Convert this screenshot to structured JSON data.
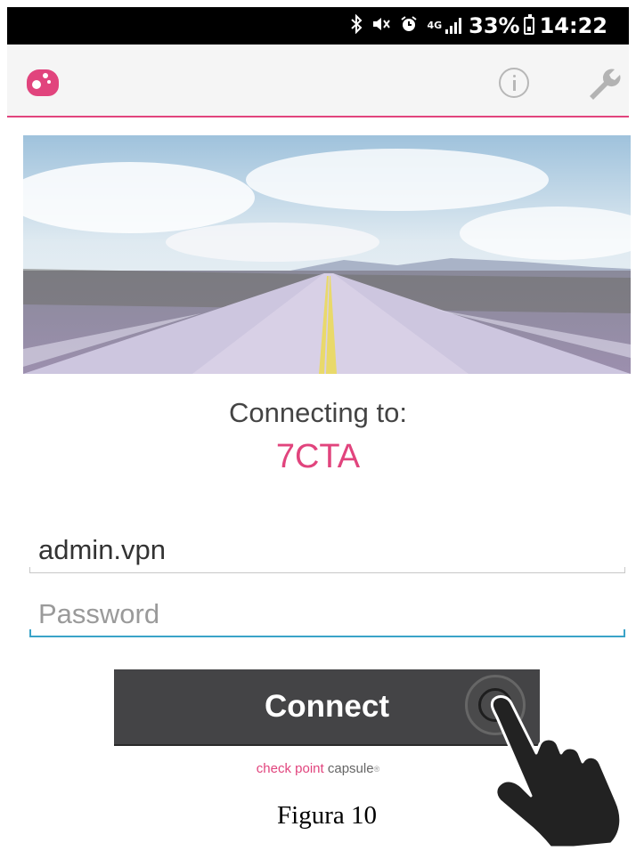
{
  "status_bar": {
    "network_type": "4G",
    "battery_percent": "33%",
    "time": "14:22",
    "icons": [
      "bluetooth-icon",
      "mute-icon",
      "alarm-icon",
      "signal-icon",
      "battery-icon"
    ]
  },
  "app_bar": {
    "logo_icon": "capsule-logo-icon",
    "info_icon": "info-icon",
    "settings_icon": "wrench-icon"
  },
  "hero": {
    "icon": "road-landscape-image"
  },
  "connection": {
    "label": "Connecting to:",
    "site": "7CTA"
  },
  "form": {
    "username_value": "admin.vpn",
    "password_placeholder": "Password"
  },
  "connect_button": {
    "label": "Connect"
  },
  "footer": {
    "brand_part1": "check point",
    "brand_part2": "capsule",
    "brand_mark": "®"
  },
  "caption": "Figura 10",
  "colors": {
    "accent": "#e1447d",
    "focus": "#3aa3c8",
    "button": "#444446"
  }
}
